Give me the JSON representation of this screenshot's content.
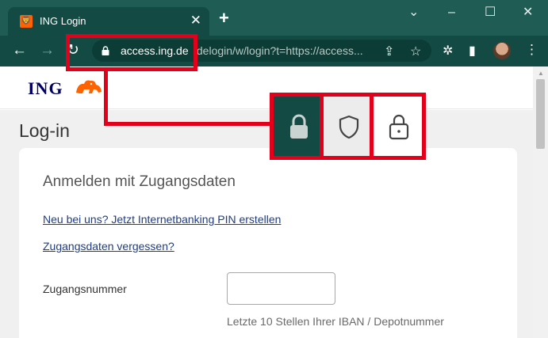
{
  "browser": {
    "tab_title": "ING Login",
    "tab_favicon": "ING",
    "tab_close_icon": "✕",
    "new_tab_icon": "+",
    "window_controls": [
      "⌄",
      "–",
      "☐",
      "✕"
    ],
    "url_host": "access.ing.de",
    "url_path": "/delogin/w/login?t=https://access...",
    "nav_back_icon": "←",
    "nav_forward_icon": "→",
    "reload_icon": "↻",
    "share_icon": "⇪",
    "bookmark_icon": "☆",
    "extensions_icon": "✲",
    "sidepanel_icon": "▮",
    "menu_icon": "⋮",
    "colors": {
      "tabbar": "#1f5c54",
      "toolbar": "#134b44",
      "omnibox": "#0c3c36"
    }
  },
  "site": {
    "logo_text": "ING",
    "brand_color": "#ff6200",
    "page_title": "Log-in",
    "card_title": "Anmelden mit Zugangsdaten",
    "link_new_pin": "Neu bei uns? Jetzt Internetbanking PIN erstellen",
    "link_forgot": "Zugangsdaten vergessen?",
    "field_label": "Zugangsnummer",
    "field_value": "",
    "field_hint": "Letzte 10 Stellen Ihrer IBAN / Depotnummer"
  },
  "annotation": {
    "highlight_color": "#e4001b",
    "lock_icons": [
      "lock-filled-icon",
      "shield-icon",
      "lock-outline-icon"
    ]
  }
}
